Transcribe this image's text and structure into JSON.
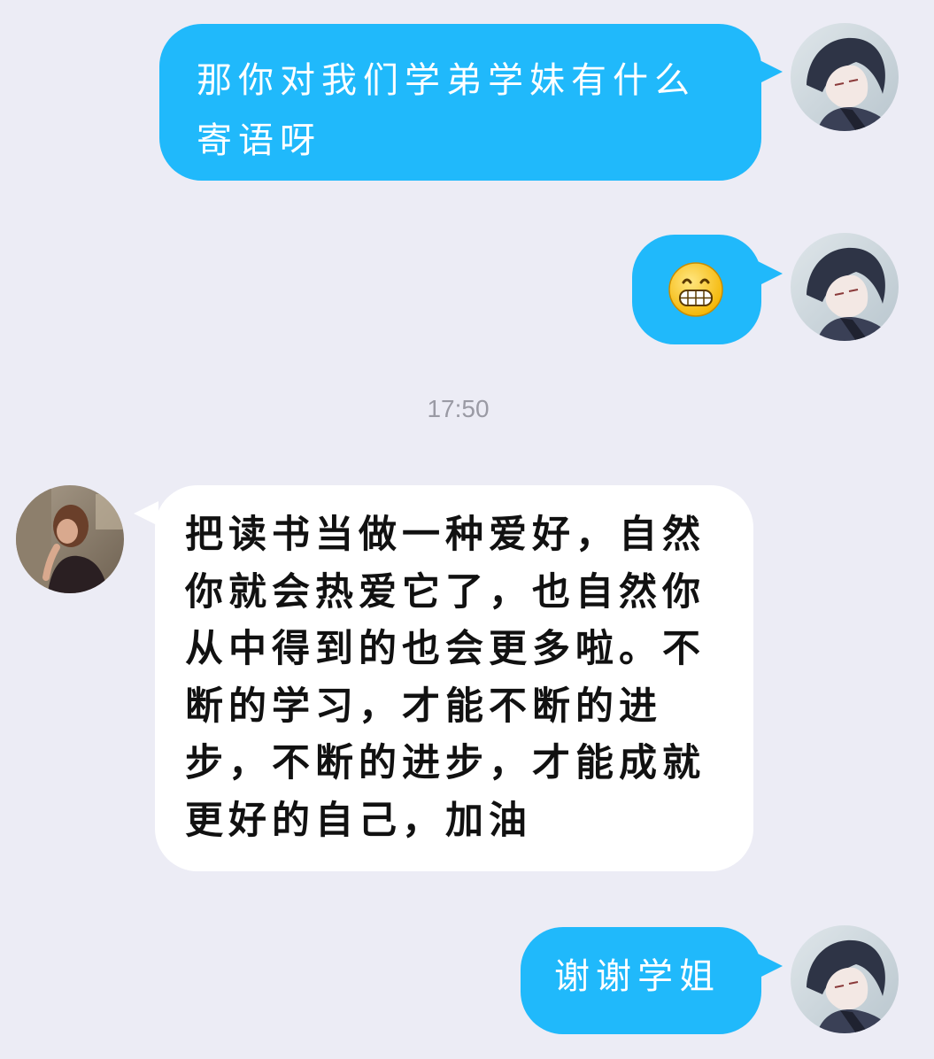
{
  "theme": {
    "background": "#ececf5",
    "outgoing_bubble": "#20b9fb",
    "incoming_bubble": "#ffffff"
  },
  "messages": [
    {
      "side": "outgoing",
      "text": "那你对我们学弟学妹有什么寄语呀",
      "avatar": "anime-avatar"
    },
    {
      "side": "outgoing",
      "emoji": "😁",
      "emoji_name": "grinning-face-icon",
      "avatar": "anime-avatar"
    },
    {
      "timestamp": "17:50"
    },
    {
      "side": "incoming",
      "text": "把读书当做一种爱好，自然你就会热爱它了，也自然你从中得到的也会更多啦。不断的学习，才能不断的进步，不断的进步，才能成就更好的自己，加油",
      "avatar": "photo-avatar"
    },
    {
      "side": "outgoing",
      "text": "谢谢学姐",
      "avatar": "anime-avatar"
    }
  ]
}
